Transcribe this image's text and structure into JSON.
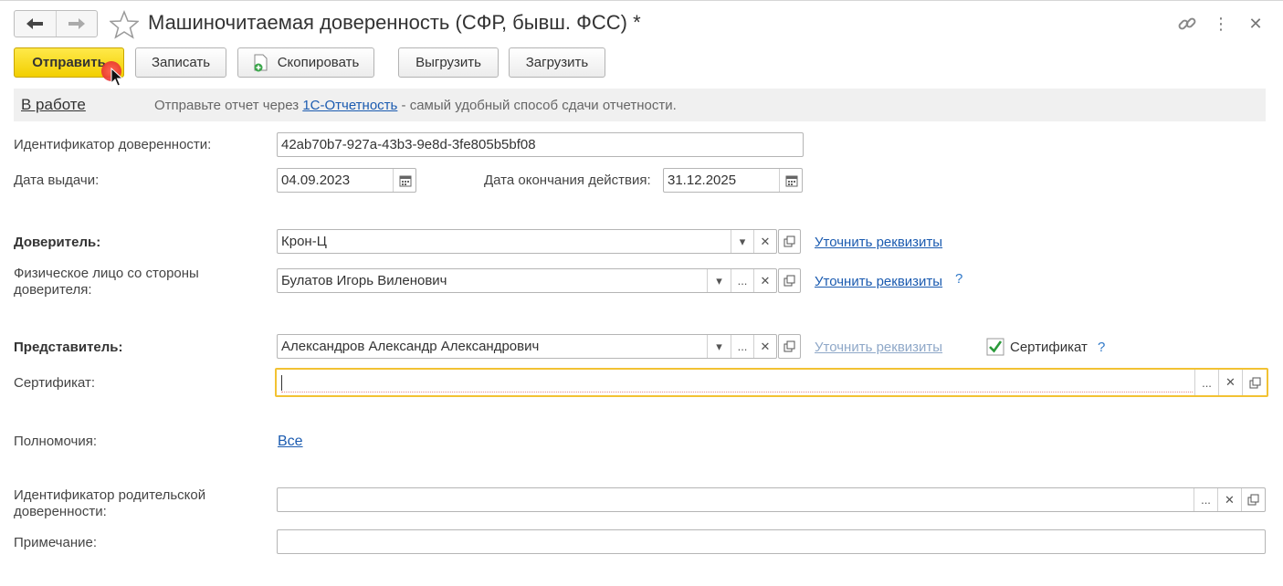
{
  "window": {
    "title": "Машиночитаемая доверенность (СФР, бывш. ФСС) *"
  },
  "toolbar": {
    "send": "Отправить",
    "save": "Записать",
    "copy": "Скопировать",
    "export": "Выгрузить",
    "import": "Загрузить"
  },
  "status": {
    "state_link": "В работе",
    "msg_before": "Отправьте отчет через ",
    "msg_link": "1С-Отчетность",
    "msg_after": " - самый удобный способ сдачи отчетности."
  },
  "form": {
    "id_label": "Идентификатор доверенности:",
    "id_value": "42ab70b7-927a-43b3-9e8d-3fe805b5bf08",
    "issue_label": "Дата выдачи:",
    "issue_value": "04.09.2023",
    "end_label": "Дата окончания действия:",
    "end_value": "31.12.2025",
    "principal_label": "Доверитель:",
    "principal_value": "Крон-Ц",
    "principal_link": "Уточнить реквизиты",
    "person_label_1": "Физическое лицо со стороны",
    "person_label_2": "доверителя:",
    "person_value": "Булатов Игорь Виленович",
    "person_link": "Уточнить реквизиты",
    "rep_label": "Представитель:",
    "rep_value": "Александров Александр Александрович",
    "rep_link": "Уточнить реквизиты",
    "cert_checkbox_label": "Сертификат",
    "cert_label": "Сертификат:",
    "cert_value": "",
    "powers_label": "Полномочия:",
    "powers_link": "Все",
    "parent_label_1": "Идентификатор родительской",
    "parent_label_2": "доверенности:",
    "parent_value": "",
    "note_label": "Примечание:",
    "note_value": ""
  },
  "glyphs": {
    "back": "🡐",
    "forward": "🡒",
    "dropdown": "▾",
    "ellipsis": "...",
    "clear": "✕",
    "help": "?",
    "more": "⋮",
    "close": "✕"
  }
}
